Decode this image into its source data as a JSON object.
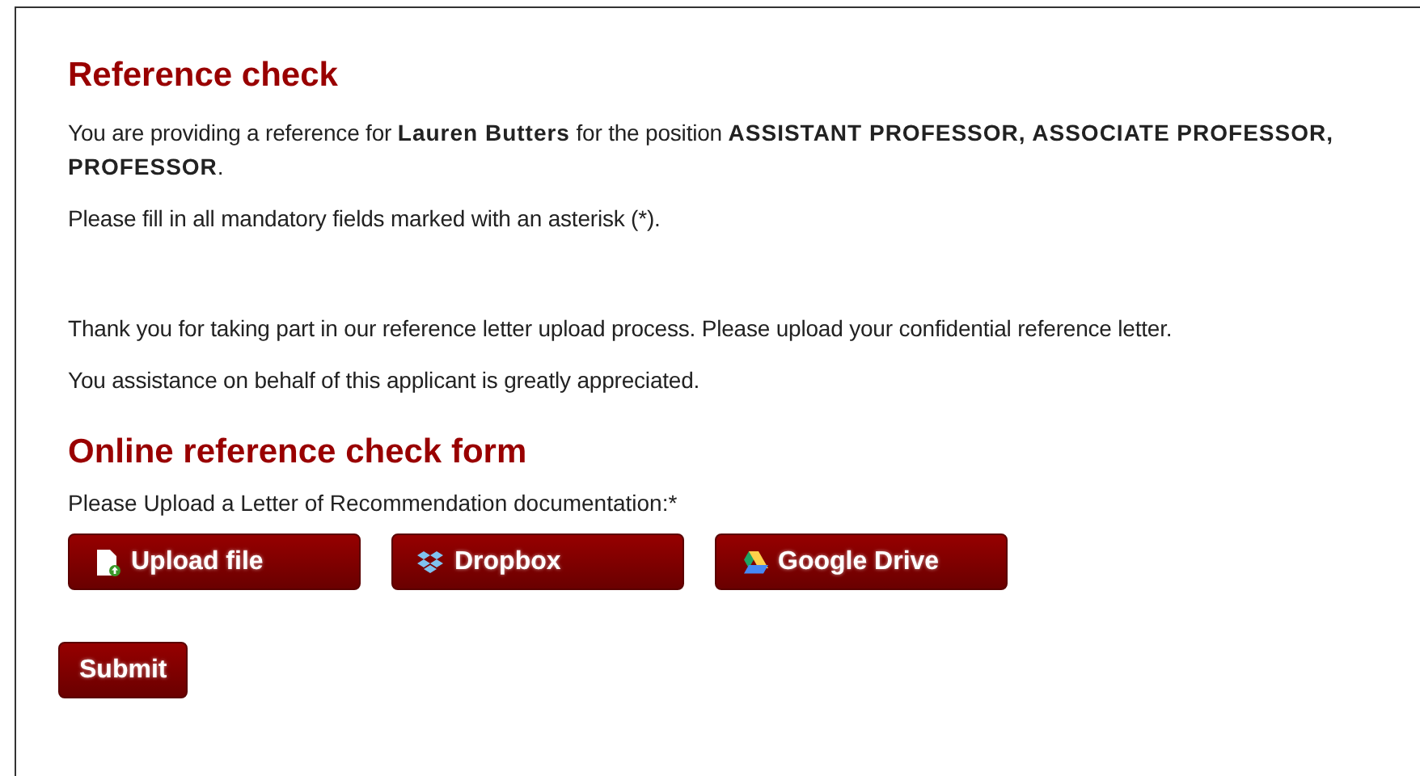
{
  "heading": "Reference check",
  "intro": "You are providing a reference for **Lauren Butters** for the position **ASSISTANT PROFESSOR, ASSOCIATE PROFESSOR, PROFESSOR**.",
  "mandatory_note": "Please fill in all mandatory fields marked with an asterisk (*).",
  "thanks": "Thank you for taking part in our reference letter upload process. Please upload your confidential reference letter.",
  "appreciation": "You assistance on behalf of this applicant is greatly appreciated.",
  "form_heading": "Online reference check form",
  "upload_label": "Please Upload a Letter of Recommendation documentation:*",
  "upload_buttons": [
    {
      "kind": "file",
      "label": "Upload file"
    },
    {
      "kind": "dropbox",
      "label": "Dropbox"
    },
    {
      "kind": "drive",
      "label": "Google Drive"
    }
  ],
  "submit": "Submit"
}
